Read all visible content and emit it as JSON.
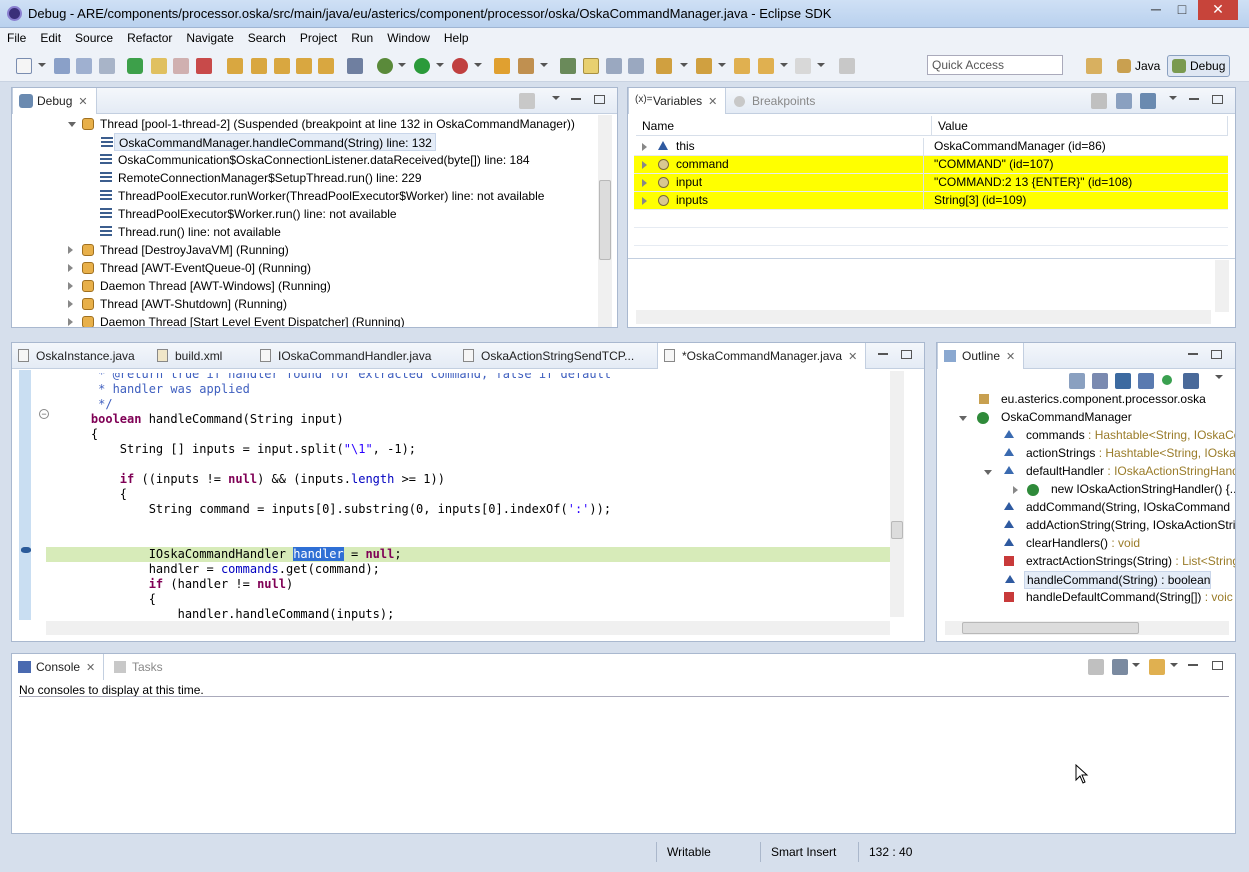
{
  "window": {
    "title": "Debug - ARE/components/processor.oska/src/main/java/eu/asterics/component/processor/oska/OskaCommandManager.java - Eclipse SDK",
    "minimize": "─",
    "maximize": "□",
    "close": "✕"
  },
  "menu": [
    "File",
    "Edit",
    "Source",
    "Refactor",
    "Navigate",
    "Search",
    "Project",
    "Run",
    "Window",
    "Help"
  ],
  "toolbar": {
    "quick_access_placeholder": "Quick Access",
    "perspectives": [
      {
        "label": "Java"
      },
      {
        "label": "Debug"
      }
    ]
  },
  "debug_view": {
    "tab": "Debug",
    "rows": [
      {
        "text": "Thread [pool-1-thread-2] (Suspended (breakpoint at line 132 in OskaCommandManager))",
        "kind": "thread",
        "indent": 0
      },
      {
        "text": "OskaCommandManager.handleCommand(String) line: 132",
        "kind": "frame",
        "indent": 1,
        "selected": true
      },
      {
        "text": "OskaCommunication$OskaConnectionListener.dataReceived(byte[]) line: 184",
        "kind": "frame",
        "indent": 1
      },
      {
        "text": "RemoteConnectionManager$SetupThread.run() line: 229",
        "kind": "frame",
        "indent": 1
      },
      {
        "text": "ThreadPoolExecutor.runWorker(ThreadPoolExecutor$Worker) line: not available",
        "kind": "frame",
        "indent": 1
      },
      {
        "text": "ThreadPoolExecutor$Worker.run() line: not available",
        "kind": "frame",
        "indent": 1
      },
      {
        "text": "Thread.run() line: not available",
        "kind": "frame",
        "indent": 1
      },
      {
        "text": "Thread [DestroyJavaVM] (Running)",
        "kind": "thread",
        "indent": 0
      },
      {
        "text": "Thread [AWT-EventQueue-0] (Running)",
        "kind": "thread",
        "indent": 0
      },
      {
        "text": "Daemon Thread [AWT-Windows] (Running)",
        "kind": "thread",
        "indent": 0
      },
      {
        "text": "Thread [AWT-Shutdown] (Running)",
        "kind": "thread",
        "indent": 0
      },
      {
        "text": "Daemon Thread [Start Level Event Dispatcher] (Running)",
        "kind": "thread",
        "indent": 0
      }
    ]
  },
  "variables_view": {
    "tabs": [
      "Variables",
      "Breakpoints"
    ],
    "columns": [
      "Name",
      "Value"
    ],
    "rows": [
      {
        "name": "this",
        "value": "OskaCommandManager  (id=86)",
        "highlight": false
      },
      {
        "name": "command",
        "value": "\"COMMAND\" (id=107)",
        "highlight": true
      },
      {
        "name": "input",
        "value": "\"COMMAND:2    13    {ENTER}\" (id=108)",
        "highlight": true
      },
      {
        "name": "inputs",
        "value": "String[3]  (id=109)",
        "highlight": true
      }
    ],
    "highlight_color": "#ffff00"
  },
  "editor": {
    "tabs": [
      "OskaInstance.java",
      "build.xml",
      "IOskaCommandHandler.java",
      "OskaActionStringSendTCP...",
      "*OskaCommandManager.java"
    ],
    "active_tab": 4,
    "lines": [
      {
        "segments": [
          {
            "t": "     * @return true if handler found for extracted command, false if default",
            "c": "cm"
          }
        ]
      },
      {
        "segments": [
          {
            "t": "     * handler was applied",
            "c": "cm"
          }
        ]
      },
      {
        "segments": [
          {
            "t": "     */",
            "c": "cm"
          }
        ]
      },
      {
        "segments": [
          {
            "t": "    ",
            "c": ""
          },
          {
            "t": "boolean",
            "c": "kw"
          },
          {
            "t": " handleCommand(String input)",
            "c": ""
          }
        ]
      },
      {
        "segments": [
          {
            "t": "    {",
            "c": ""
          }
        ]
      },
      {
        "segments": [
          {
            "t": "        String [] inputs = input.split(",
            "c": ""
          },
          {
            "t": "\"\\1\"",
            "c": "str"
          },
          {
            "t": ", -1);",
            "c": ""
          }
        ]
      },
      {
        "segments": [
          {
            "t": "",
            "c": ""
          }
        ]
      },
      {
        "segments": [
          {
            "t": "        ",
            "c": ""
          },
          {
            "t": "if",
            "c": "kw"
          },
          {
            "t": " ((inputs != ",
            "c": ""
          },
          {
            "t": "null",
            "c": "kw"
          },
          {
            "t": ") && (inputs.",
            "c": ""
          },
          {
            "t": "length",
            "c": "fld"
          },
          {
            "t": " >= 1))",
            "c": ""
          }
        ]
      },
      {
        "segments": [
          {
            "t": "        {",
            "c": ""
          }
        ]
      },
      {
        "segments": [
          {
            "t": "            String command = inputs[0].substring(0, inputs[0].indexOf(",
            "c": ""
          },
          {
            "t": "':'",
            "c": "str"
          },
          {
            "t": "));",
            "c": ""
          }
        ]
      },
      {
        "segments": [
          {
            "t": "",
            "c": ""
          }
        ]
      },
      {
        "segments": [
          {
            "t": "",
            "c": ""
          }
        ]
      },
      {
        "segments": [
          {
            "t": "            IOskaCommandHandler ",
            "c": ""
          },
          {
            "t": "handler",
            "c": "hlword"
          },
          {
            "t": " = ",
            "c": ""
          },
          {
            "t": "null",
            "c": "kw"
          },
          {
            "t": ";",
            "c": ""
          }
        ],
        "current": true
      },
      {
        "segments": [
          {
            "t": "            handler = ",
            "c": ""
          },
          {
            "t": "commands",
            "c": "fld"
          },
          {
            "t": ".get(command);",
            "c": ""
          }
        ]
      },
      {
        "segments": [
          {
            "t": "            ",
            "c": ""
          },
          {
            "t": "if",
            "c": "kw"
          },
          {
            "t": " (handler != ",
            "c": ""
          },
          {
            "t": "null",
            "c": "kw"
          },
          {
            "t": ")",
            "c": ""
          }
        ]
      },
      {
        "segments": [
          {
            "t": "            {",
            "c": ""
          }
        ]
      },
      {
        "segments": [
          {
            "t": "                handler.handleCommand(inputs);",
            "c": ""
          }
        ]
      }
    ]
  },
  "outline_view": {
    "tab": "Outline",
    "rows": [
      {
        "text": "eu.asterics.component.processor.oska",
        "type": "",
        "icon": "package-icon",
        "indent": 0
      },
      {
        "text": "OskaCommandManager",
        "type": "",
        "icon": "class-icon",
        "indent": 0,
        "expanded": true
      },
      {
        "text": "commands",
        "type": " : Hashtable<String, IOskaCo",
        "icon": "field-icon",
        "indent": 1
      },
      {
        "text": "actionStrings",
        "type": " : Hashtable<String, IOska",
        "icon": "field-icon",
        "indent": 1
      },
      {
        "text": "defaultHandler",
        "type": " : IOskaActionStringHand",
        "icon": "field-icon",
        "indent": 1,
        "expanded": true
      },
      {
        "text": "new IOskaActionStringHandler() {...",
        "type": "",
        "icon": "anon-class-icon",
        "indent": 2
      },
      {
        "text": "addCommand(String, IOskaCommand",
        "type": "",
        "icon": "method-icon",
        "indent": 1
      },
      {
        "text": "addActionString(String, IOskaActionStri",
        "type": "",
        "icon": "method-icon",
        "indent": 1
      },
      {
        "text": "clearHandlers()",
        "type": " : void",
        "icon": "method-icon",
        "indent": 1
      },
      {
        "text": "extractActionStrings(String)",
        "type": " : List<String",
        "icon": "private-method-icon",
        "indent": 1
      },
      {
        "text": "handleCommand(String) : boolean",
        "type": "",
        "icon": "method-icon",
        "indent": 1,
        "selected": true
      },
      {
        "text": "handleDefaultCommand(String[])",
        "type": " : voic",
        "icon": "private-method-icon",
        "indent": 1
      }
    ]
  },
  "console_view": {
    "tabs": [
      "Console",
      "Tasks"
    ],
    "message": "No consoles to display at this time."
  },
  "status": {
    "writable": "Writable",
    "insert_mode": "Smart Insert",
    "position": "132 : 40"
  }
}
